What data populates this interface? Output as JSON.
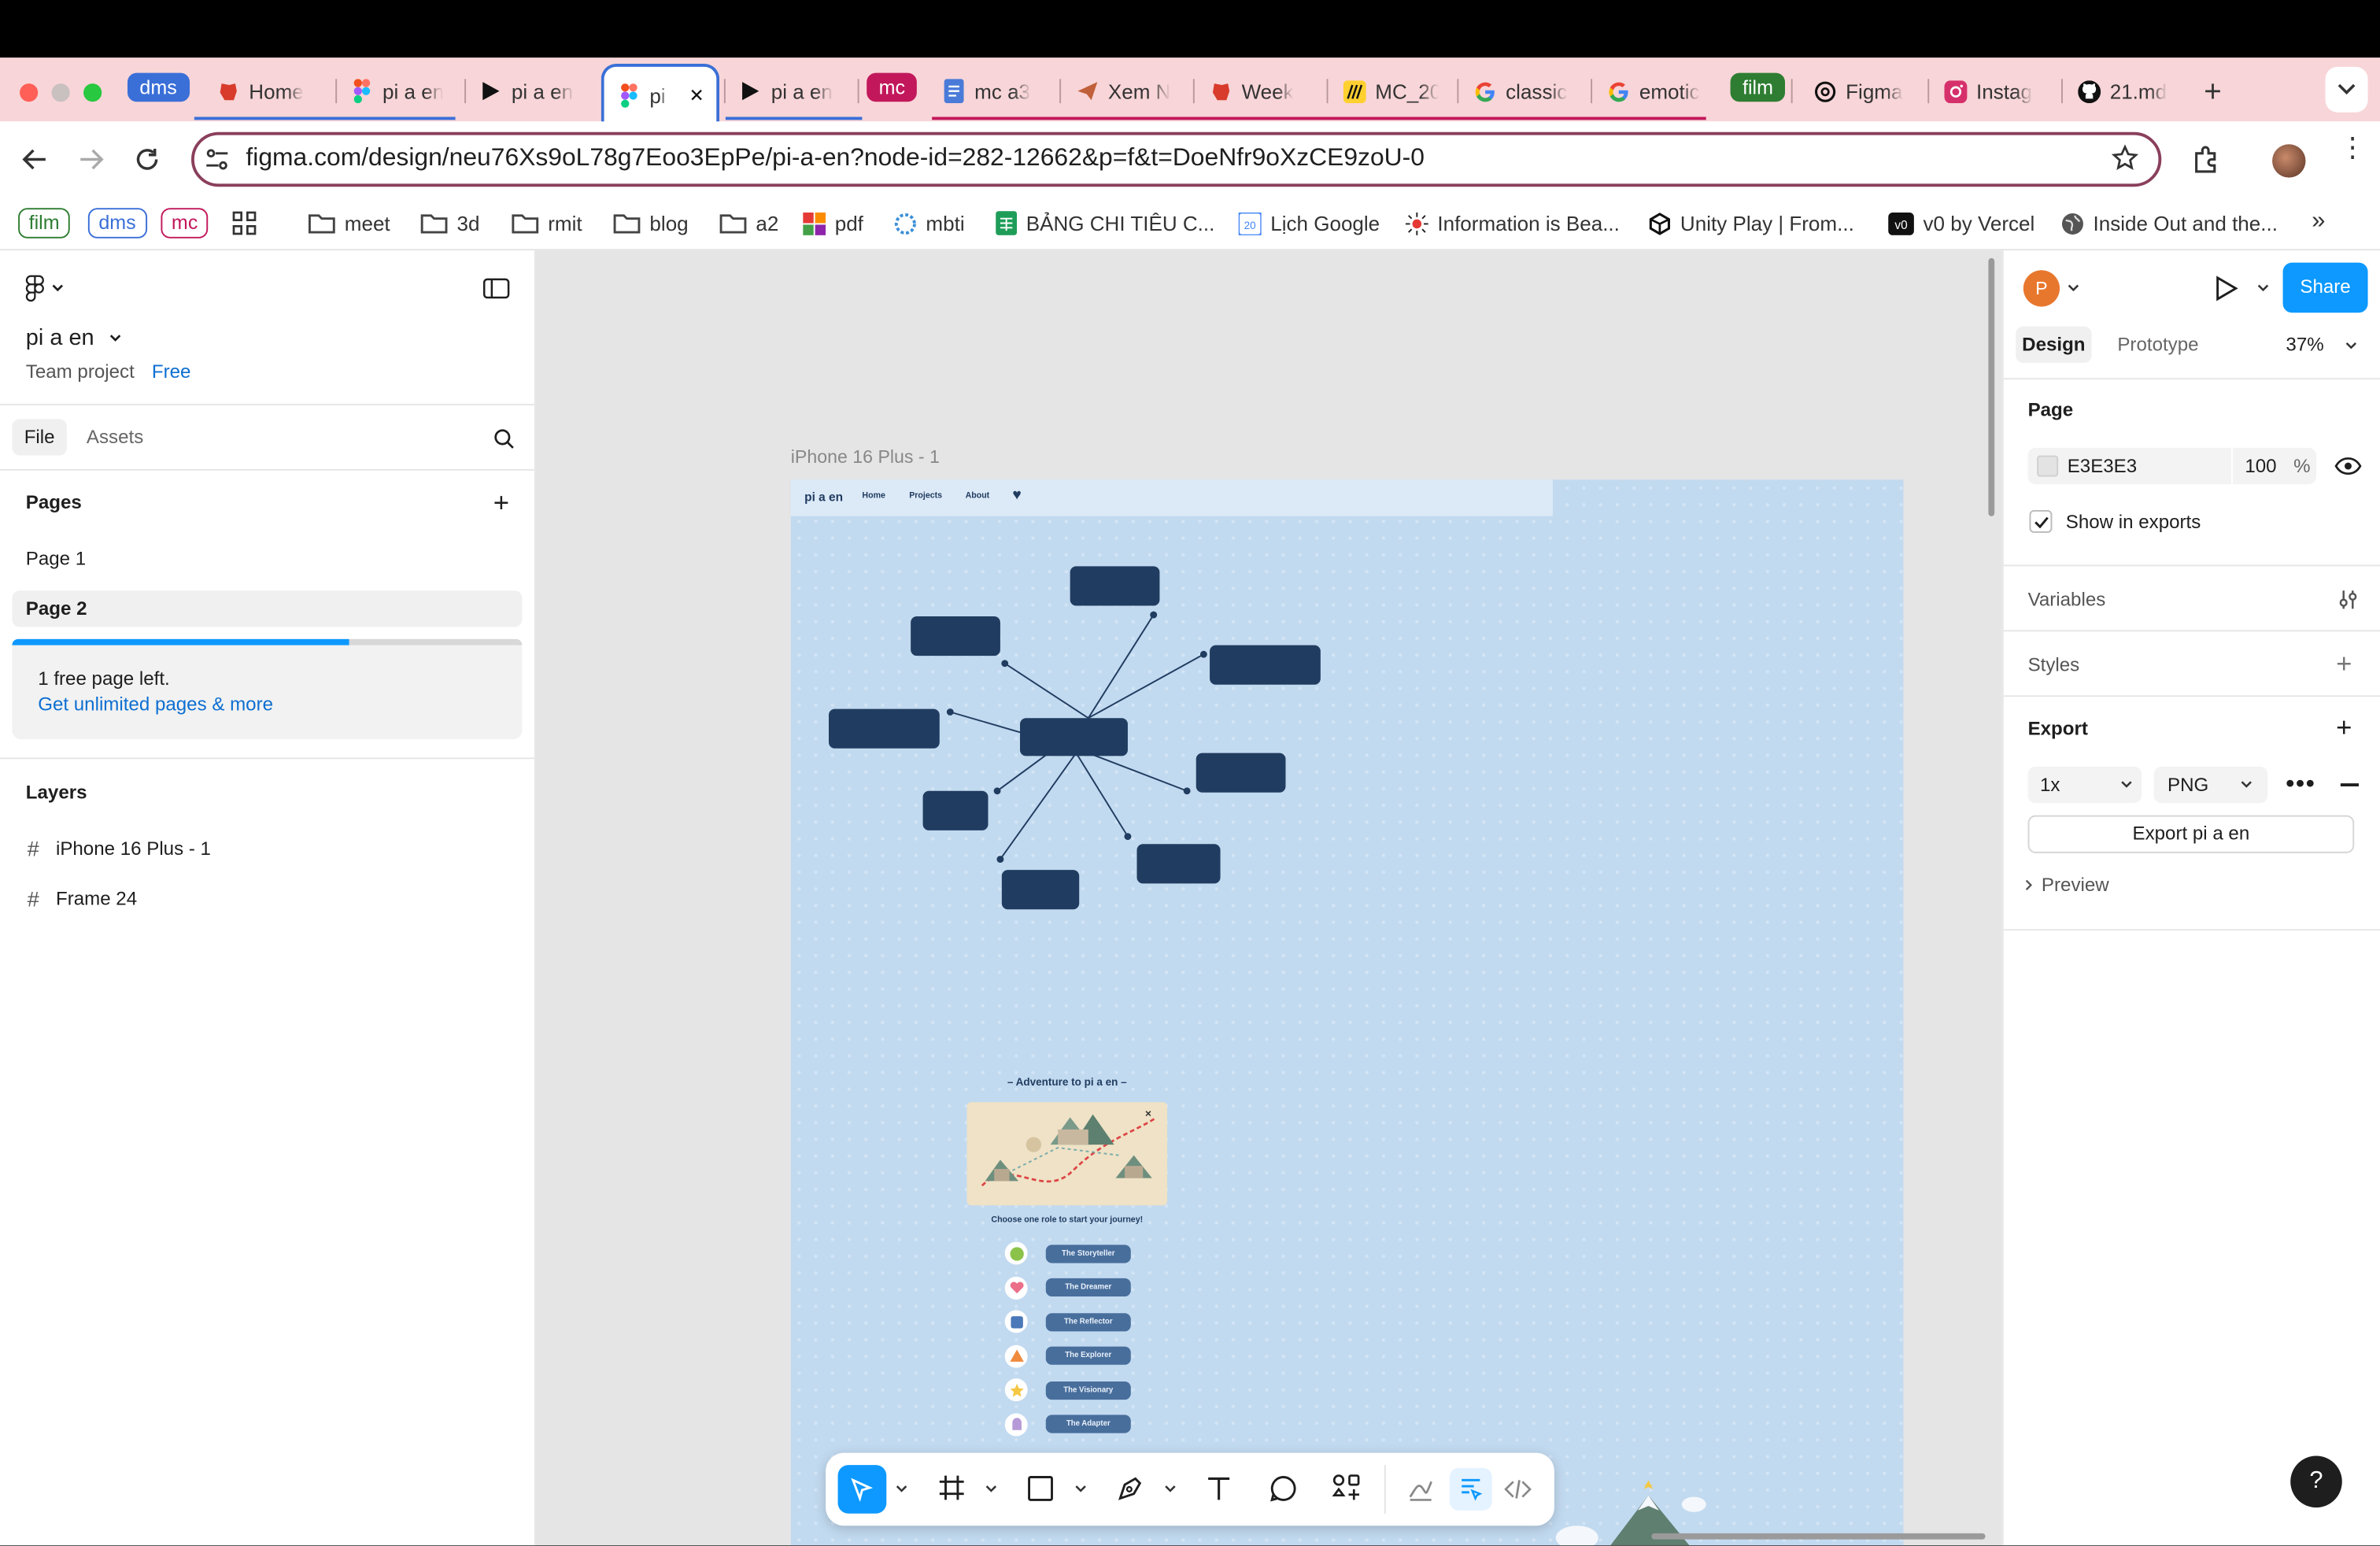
{
  "tabs": [
    {
      "label": "dms",
      "kind": "chip",
      "color": "#3a6fd8"
    },
    {
      "label": "Home",
      "kind": "tab",
      "icon": "red-blob-icon"
    },
    {
      "label": "pi a en",
      "kind": "tab",
      "icon": "figma-icon"
    },
    {
      "label": "pi a en",
      "kind": "tab",
      "icon": "play-icon"
    },
    {
      "label": "pi",
      "kind": "active",
      "icon": "figma-icon"
    },
    {
      "label": "pi a en",
      "kind": "tab",
      "icon": "play-icon"
    },
    {
      "label": "mc",
      "kind": "chip",
      "color": "#c2185b"
    },
    {
      "label": "mc a3",
      "kind": "tab",
      "icon": "docs-icon"
    },
    {
      "label": "Xem N",
      "kind": "tab",
      "icon": "paper-plane-icon"
    },
    {
      "label": "Week",
      "kind": "tab",
      "icon": "red-blob-icon"
    },
    {
      "label": "MC_20",
      "kind": "tab",
      "icon": "miro-icon"
    },
    {
      "label": "classic",
      "kind": "tab",
      "icon": "google-icon"
    },
    {
      "label": "emotic",
      "kind": "tab",
      "icon": "google-icon"
    },
    {
      "label": "film",
      "kind": "chip",
      "color": "#2e7d32"
    },
    {
      "label": "Figma",
      "kind": "tab",
      "icon": "openai-icon"
    },
    {
      "label": "Instag",
      "kind": "tab",
      "icon": "instagram-icon"
    },
    {
      "label": "21.md",
      "kind": "tab",
      "icon": "github-icon"
    }
  ],
  "browser": {
    "url": "figma.com/design/neu76Xs9oL78g7Eoo3EpPe/pi-a-en?node-id=282-12662&p=f&t=DoeNfr9oXzCE9zoU-0"
  },
  "bookmarks": [
    {
      "label": "film",
      "kind": "chip",
      "color": "#2e7d32"
    },
    {
      "label": "dms",
      "kind": "chip",
      "color": "#3a6fd8"
    },
    {
      "label": "mc",
      "kind": "chip",
      "color": "#c2185b"
    },
    {
      "label": "",
      "kind": "apps"
    },
    {
      "label": "meet",
      "kind": "folder"
    },
    {
      "label": "3d",
      "kind": "folder"
    },
    {
      "label": "rmit",
      "kind": "folder"
    },
    {
      "label": "blog",
      "kind": "folder"
    },
    {
      "label": "a2",
      "kind": "folder"
    },
    {
      "label": "pdf",
      "kind": "site",
      "icon": "grid-color-icon"
    },
    {
      "label": "mbti",
      "kind": "site",
      "icon": "dots-circle-icon"
    },
    {
      "label": "BẢNG CHI TIÊU C...",
      "kind": "site",
      "icon": "sheets-icon"
    },
    {
      "label": "Lịch Google",
      "kind": "site",
      "icon": "calendar-icon"
    },
    {
      "label": "Information is Bea...",
      "kind": "site",
      "icon": "sun-icon"
    },
    {
      "label": "Unity Play | From...",
      "kind": "site",
      "icon": "unity-icon"
    },
    {
      "label": "v0 by Vercel",
      "kind": "site",
      "icon": "v0-icon"
    },
    {
      "label": "Inside Out and the...",
      "kind": "site",
      "icon": "globe-icon"
    }
  ],
  "left": {
    "file_name": "pi a en",
    "team": "Team project",
    "plan": "Free",
    "tabs": [
      "File",
      "Assets"
    ],
    "pages_title": "Pages",
    "pages": [
      "Page 1",
      "Page 2"
    ],
    "page_limit": "1 free page left.",
    "upgrade": "Get unlimited pages & more",
    "page_usage": 0.66,
    "layers_title": "Layers",
    "layers": [
      "iPhone 16 Plus - 1",
      "Frame 24"
    ]
  },
  "canvas": {
    "frame_label": "iPhone 16 Plus - 1",
    "site_logo": "pi a en",
    "nav": [
      "Home",
      "Projects",
      "About"
    ],
    "adventure_title": "– Adventure to pi a en –",
    "choose_text": "Choose one role to start your journey!",
    "roles": [
      "The Storyteller",
      "The Dreamer",
      "The Reflector",
      "The Explorer",
      "The Visionary",
      "The Adapter"
    ]
  },
  "right": {
    "tabs": [
      "Design",
      "Prototype"
    ],
    "zoom": "37%",
    "share": "Share",
    "avatar": "P",
    "page_title": "Page",
    "page_color": "E3E3E3",
    "page_opacity": "100",
    "percent": "%",
    "show_in_exports": "Show in exports",
    "variables": "Variables",
    "styles": "Styles",
    "export": "Export",
    "export_scale": "1x",
    "export_format": "PNG",
    "export_button": "Export pi a en",
    "preview": "Preview"
  },
  "help": "?"
}
